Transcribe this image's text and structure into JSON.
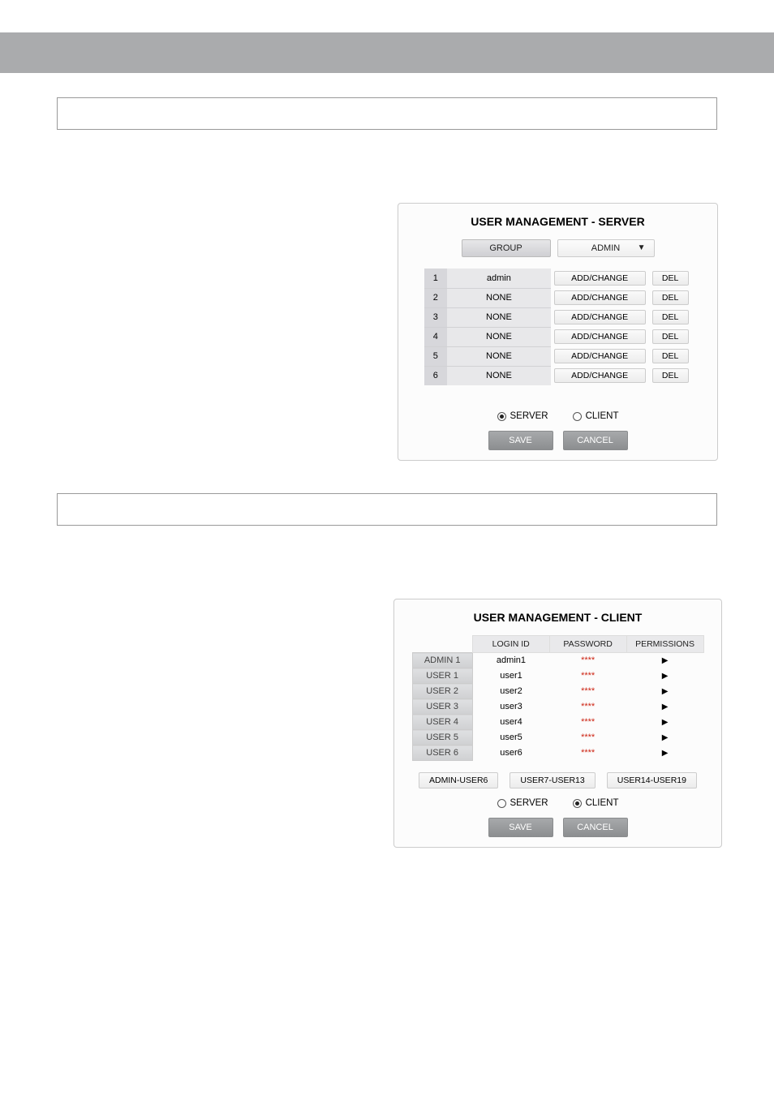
{
  "server_panel": {
    "title": "USER MANAGEMENT - SERVER",
    "group_label": "GROUP",
    "group_value": "ADMIN",
    "rows": [
      {
        "idx": "1",
        "name": "admin",
        "action": "ADD/CHANGE",
        "del": "DEL"
      },
      {
        "idx": "2",
        "name": "NONE",
        "action": "ADD/CHANGE",
        "del": "DEL"
      },
      {
        "idx": "3",
        "name": "NONE",
        "action": "ADD/CHANGE",
        "del": "DEL"
      },
      {
        "idx": "4",
        "name": "NONE",
        "action": "ADD/CHANGE",
        "del": "DEL"
      },
      {
        "idx": "5",
        "name": "NONE",
        "action": "ADD/CHANGE",
        "del": "DEL"
      },
      {
        "idx": "6",
        "name": "NONE",
        "action": "ADD/CHANGE",
        "del": "DEL"
      }
    ],
    "mode_server": "SERVER",
    "mode_client": "CLIENT",
    "save": "SAVE",
    "cancel": "CANCEL"
  },
  "client_panel": {
    "title": "USER MANAGEMENT - CLIENT",
    "head_login": "LOGIN ID",
    "head_pw": "PASSWORD",
    "head_perm": "PERMISSIONS",
    "rows": [
      {
        "label": "ADMIN 1",
        "login": "admin1",
        "pw": "****"
      },
      {
        "label": "USER 1",
        "login": "user1",
        "pw": "****"
      },
      {
        "label": "USER 2",
        "login": "user2",
        "pw": "****"
      },
      {
        "label": "USER 3",
        "login": "user3",
        "pw": "****"
      },
      {
        "label": "USER 4",
        "login": "user4",
        "pw": "****"
      },
      {
        "label": "USER 5",
        "login": "user5",
        "pw": "****"
      },
      {
        "label": "USER 6",
        "login": "user6",
        "pw": "****"
      }
    ],
    "page1": "ADMIN-USER6",
    "page2": "USER7-USER13",
    "page3": "USER14-USER19",
    "mode_server": "SERVER",
    "mode_client": "CLIENT",
    "save": "SAVE",
    "cancel": "CANCEL"
  }
}
